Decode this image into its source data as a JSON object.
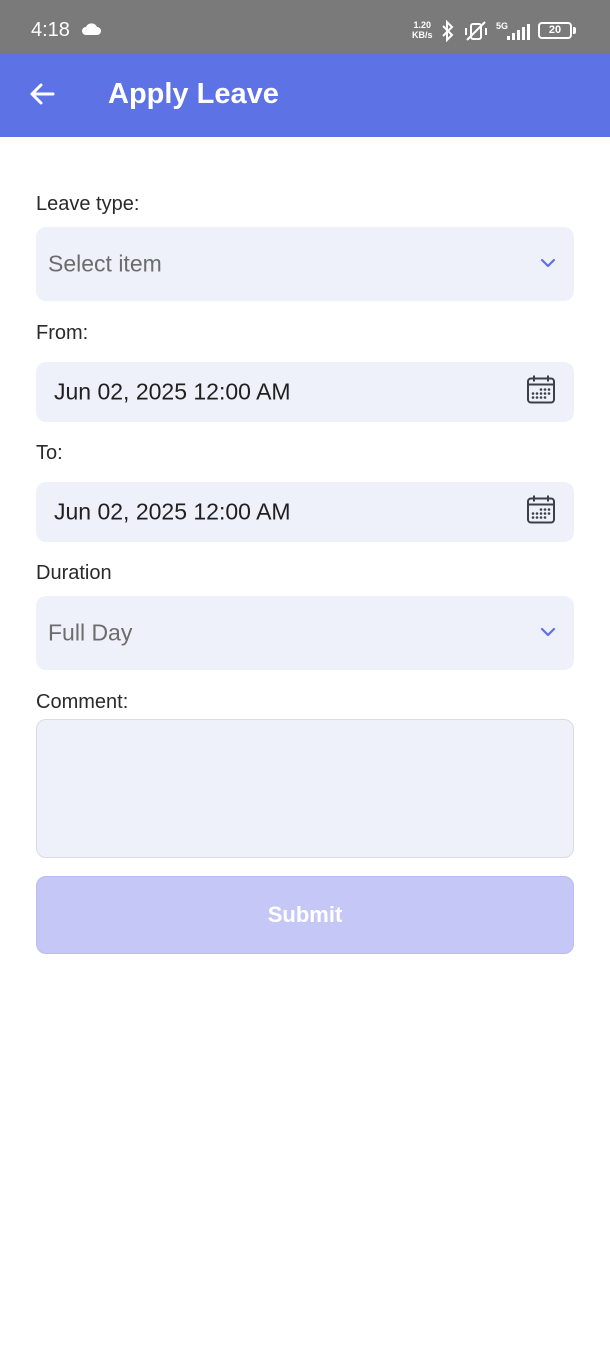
{
  "status_bar": {
    "time": "4:18",
    "speed_value": "1.20",
    "speed_unit": "KB/s",
    "network": "5G",
    "battery": "20"
  },
  "app_bar": {
    "title": "Apply Leave",
    "back_icon": "arrow-left-icon",
    "color": "#5d72e4"
  },
  "form": {
    "leave_type": {
      "label": "Leave type:",
      "placeholder": "Select item"
    },
    "from": {
      "label": "From:",
      "value": "Jun 02, 2025 12:00 AM"
    },
    "to": {
      "label": "To:",
      "value": "Jun 02, 2025 12:00 AM"
    },
    "duration": {
      "label": "Duration",
      "value": "Full Day"
    },
    "comment": {
      "label": "Comment:",
      "value": ""
    },
    "submit_label": "Submit"
  },
  "colors": {
    "field_bg": "#eff1fa",
    "submit_disabled": "#c5c8f6",
    "accent": "#5d72e4"
  }
}
